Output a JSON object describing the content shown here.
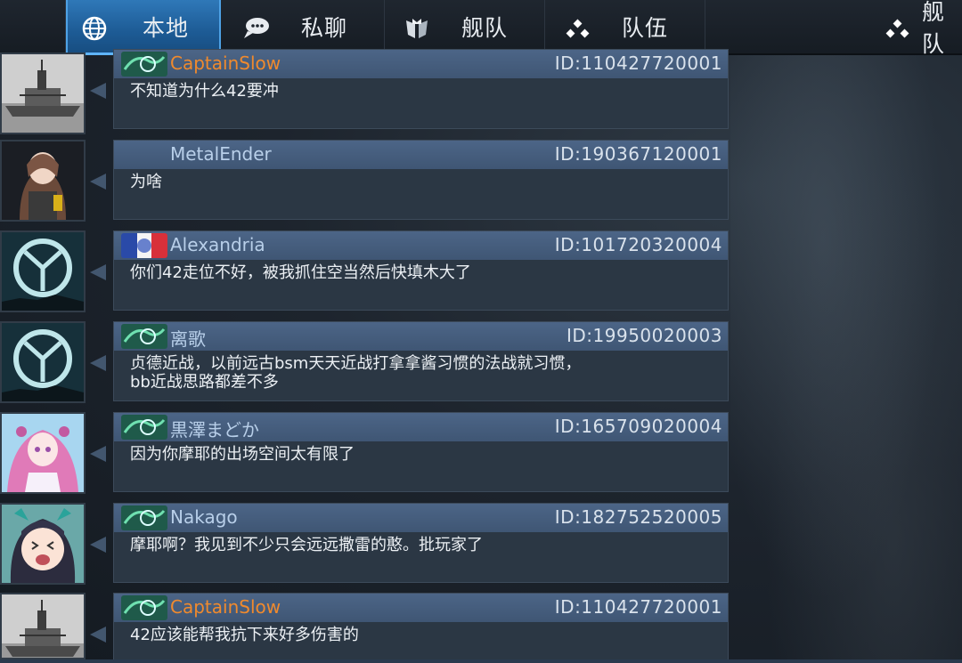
{
  "tabs": [
    {
      "label": "本地",
      "icon": "globe-icon",
      "active": true
    },
    {
      "label": "私聊",
      "icon": "chat-bubble-icon",
      "active": false
    },
    {
      "label": "舰队",
      "icon": "fleet-shield-icon",
      "active": false
    },
    {
      "label": "队伍",
      "icon": "team-dots-icon",
      "active": false
    },
    {
      "label": "舰队",
      "icon": "team-dots-icon",
      "active": false
    }
  ],
  "messages": [
    {
      "name": "CaptainSlow",
      "id": "ID:110427720001",
      "text": "不知道为什么42要冲",
      "name_color": "orange",
      "avatar": "battleship-photo",
      "badge": "green-swirl"
    },
    {
      "name": "MetalEnder",
      "id": "ID:190367120001",
      "text": "为啥",
      "name_color": "blue",
      "avatar": "anime-girl-armored",
      "badge": "none"
    },
    {
      "name": "Alexandria",
      "id": "ID:101720320004",
      "text": "你们42走位不好，被我抓住空当然后快填木大了",
      "name_color": "blue",
      "avatar": "default-crest",
      "badge": "french-flag"
    },
    {
      "name": "离歌",
      "id": "ID:19950020003",
      "text": "贞德近战，以前远古bsm天天近战打拿拿酱习惯的法战就习惯，\nbb近战思路都差不多",
      "name_color": "blue",
      "avatar": "default-crest",
      "badge": "green-swirl"
    },
    {
      "name": "黒澤まどか",
      "id": "ID:165709020004",
      "text": "因为你摩耶的出场空间太有限了",
      "name_color": "blue",
      "avatar": "anime-girl-pink",
      "badge": "green-swirl"
    },
    {
      "name": "Nakago",
      "id": "ID:182752520005",
      "text": "摩耶啊？我见到不少只会远远撒雷的憨。批玩家了",
      "name_color": "blue",
      "avatar": "anime-girl-cat",
      "badge": "green-swirl"
    },
    {
      "name": "CaptainSlow",
      "id": "ID:110427720001",
      "text": "42应该能帮我抗下来好多伤害的",
      "name_color": "orange",
      "avatar": "battleship-photo",
      "badge": "green-swirl"
    }
  ]
}
